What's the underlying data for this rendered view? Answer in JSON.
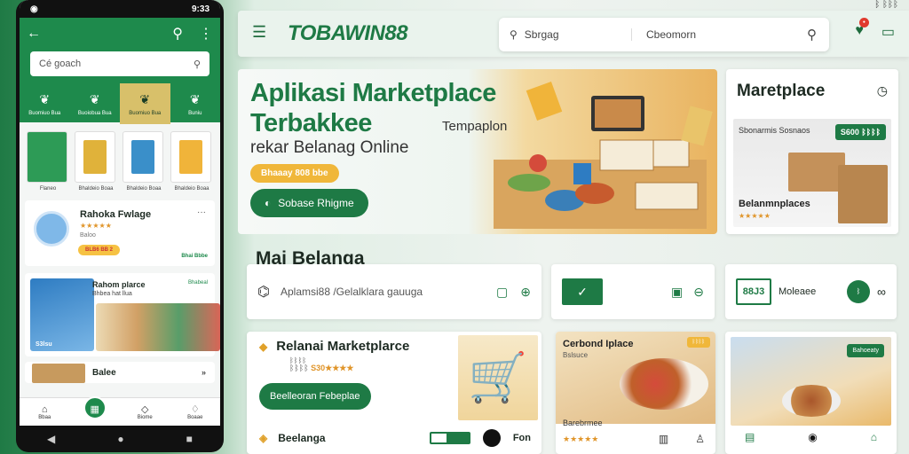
{
  "phone": {
    "status_time": "9:33",
    "search_placeholder": "Cé goach",
    "categories": [
      {
        "label": "Buomiuo Bua",
        "icon": "leaf-icon"
      },
      {
        "label": "Buoiobua Bua",
        "icon": "leaf-icon"
      },
      {
        "label": "Buomiuo Bua",
        "icon": "leaf-icon"
      },
      {
        "label": "Buniu",
        "icon": "leaf-icon"
      }
    ],
    "products": [
      {
        "label": "Flaneo",
        "color": "#2d9b56"
      },
      {
        "label": "Bhaldeio Boaa",
        "color": "#e0b23a"
      },
      {
        "label": "Bhaldeio Boaa",
        "color": "#3a8fc9"
      },
      {
        "label": "Bhaldeio Boaa",
        "color": "#f0b43a"
      }
    ],
    "store": {
      "name": "Rahoka Fwlage",
      "stars": "★★★★★",
      "sub": "Baloo",
      "badge": "BLB6 BB 2",
      "link": "Bhai Bbbe"
    },
    "promo": {
      "title": "Rahom plarce",
      "tag": "Bhabeal",
      "sub": "Bhbea hat llua",
      "price": "S3lsu"
    },
    "bottom": {
      "label": "Balee",
      "more": "»"
    },
    "nav": [
      {
        "label": "Bbaa",
        "icon": "home-icon"
      },
      {
        "label": "",
        "icon": "store-icon"
      },
      {
        "label": "Biome",
        "icon": "bag-icon"
      },
      {
        "label": "Boaae",
        "icon": "bell-icon"
      }
    ]
  },
  "topbar": {
    "brand": "TOBAWIN88",
    "search_left": "Sbrgag",
    "search_right": "Cbeomorn",
    "status": "ᛒ ᛒᛒᛒ"
  },
  "hero": {
    "title_line1": "Aplikasi Marketplace",
    "title_line2": "Terbakkee",
    "tagline": "Tempaplon",
    "subtitle": "rekar Belanag Online",
    "pill": "Bhaaay 808 bbe",
    "cta": "Sobase Rhigme"
  },
  "marketplace_card": {
    "title": "Maretplace",
    "img_label": "Sbonarmis Sosnaos",
    "badge": "S600 ᛒᛒᛒᛒ",
    "bottom": "Belanmnplaces",
    "stars": "★★★★★"
  },
  "section": {
    "title": "Mai Belanga"
  },
  "row_cards": {
    "first": {
      "text": "Aplamsi88 /Gelalklara gauuga"
    },
    "second": {
      "badge": "✓"
    },
    "third": {
      "badge": "88J3",
      "label": "Moleaee",
      "circle": "ᛒ"
    }
  },
  "card1": {
    "title": "Relanai Marketplarce",
    "sub": "ᛒᛒᛒᛒ",
    "price_prefix": "ᛒᛒᛒᛒ",
    "price": "S30★★★★",
    "button": "Beelleoran Febeplae",
    "footer": "Beelanga",
    "footer_n": "Fon"
  },
  "card2": {
    "title": "Cerbond Iplace",
    "sub": "Bslsuce",
    "badge": "ᛒᛒᛒᛒ",
    "bottom": "Barebrmee",
    "stars": "★★★★★"
  },
  "card3": {
    "badge": "Bahoeaty"
  }
}
